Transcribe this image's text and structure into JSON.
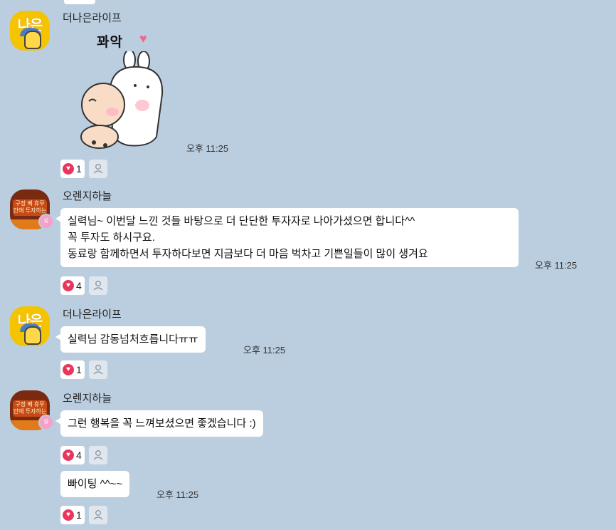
{
  "messages": [
    {
      "sender": "더나은라이프",
      "avatar_text": "나은",
      "sticker_text": "꽈악",
      "time": "오후 11:25",
      "likes": "1"
    },
    {
      "sender": "오렌지하늘",
      "avatar_text": "구정 배 휴무안에 투자하는",
      "lines": [
        "실력님~ 이번달 느낀 것들 바탕으로 더 단단한 투자자로 나아가셨으면 합니다^^",
        "꼭 투자도 하시구요.",
        "동료랑 함께하면서 투자하다보면 지금보다 더 마음 벅차고 기쁜일들이 많이 생겨요"
      ],
      "time": "오후 11:25",
      "likes": "4"
    },
    {
      "sender": "더나은라이프",
      "avatar_text": "나은",
      "text": "실력님 감동넘처흐릅니다ㅠㅠ",
      "time": "오후 11:25",
      "likes": "1"
    },
    {
      "sender": "오렌지하늘",
      "avatar_text": "구정 배 휴무안에 투자하는",
      "text": "그런 행복을 꼭 느껴보셨으면 좋겠습니다 :)",
      "likes": "4"
    },
    {
      "text": "빠이팅 ^^~~",
      "time": "오후 11:25",
      "likes": "1"
    }
  ],
  "icons": {
    "heart": "heart-icon",
    "person": "person-icon",
    "crown": "crown-icon"
  },
  "colors": {
    "background": "#bacee0",
    "bubble": "#ffffff",
    "heart": "#e8365d",
    "avatar_yellow": "#f5c400",
    "crown": "#f5a0c8"
  }
}
